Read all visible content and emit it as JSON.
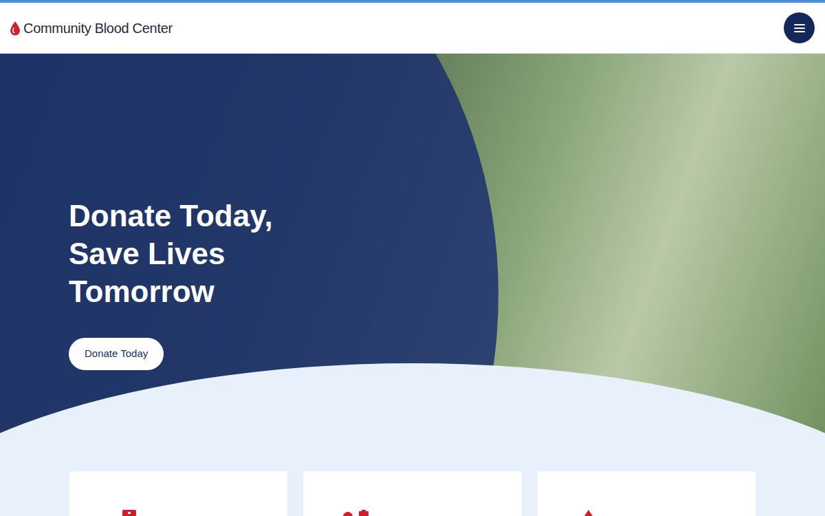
{
  "header": {
    "logo_text": "Community Blood Center"
  },
  "hero": {
    "title_lines": [
      "Donate Today,",
      "Save Lives",
      "Tomorrow"
    ],
    "button": "Donate Today"
  }
}
